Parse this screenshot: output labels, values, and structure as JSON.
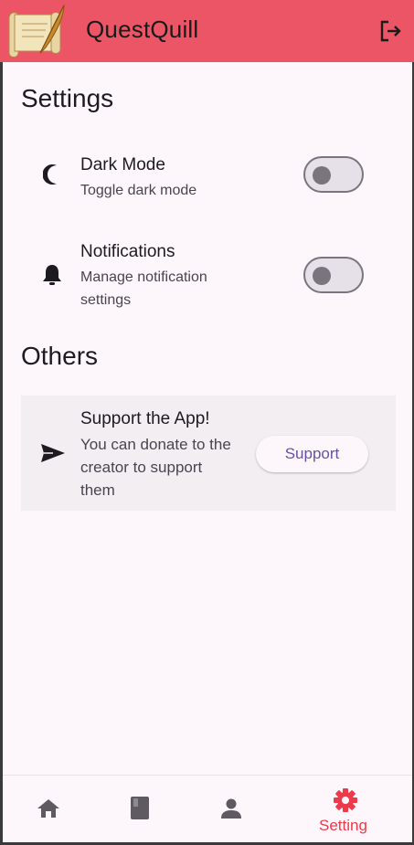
{
  "app": {
    "title": "QuestQuill"
  },
  "settings": {
    "heading": "Settings",
    "dark_mode": {
      "title": "Dark Mode",
      "subtitle": "Toggle dark mode",
      "enabled": false
    },
    "notifications": {
      "title": "Notifications",
      "subtitle_line1": "Manage notification",
      "subtitle_line2": "settings",
      "enabled": false
    }
  },
  "others": {
    "heading": "Others",
    "support": {
      "title": "Support the App!",
      "line1": "You can donate to the",
      "line2": "creator to support",
      "line3": "them",
      "button": "Support"
    }
  },
  "bottom_nav": {
    "active": "Setting",
    "items": [
      {
        "icon": "home-icon"
      },
      {
        "icon": "book-icon"
      },
      {
        "icon": "person-icon"
      },
      {
        "icon": "gear-icon",
        "label": "Setting"
      }
    ]
  },
  "colors": {
    "appbar": "#ec5565",
    "accent": "#ec3a4a",
    "background": "#fdf7fb",
    "card": "#f3eef2",
    "button_text": "#6750a4"
  }
}
